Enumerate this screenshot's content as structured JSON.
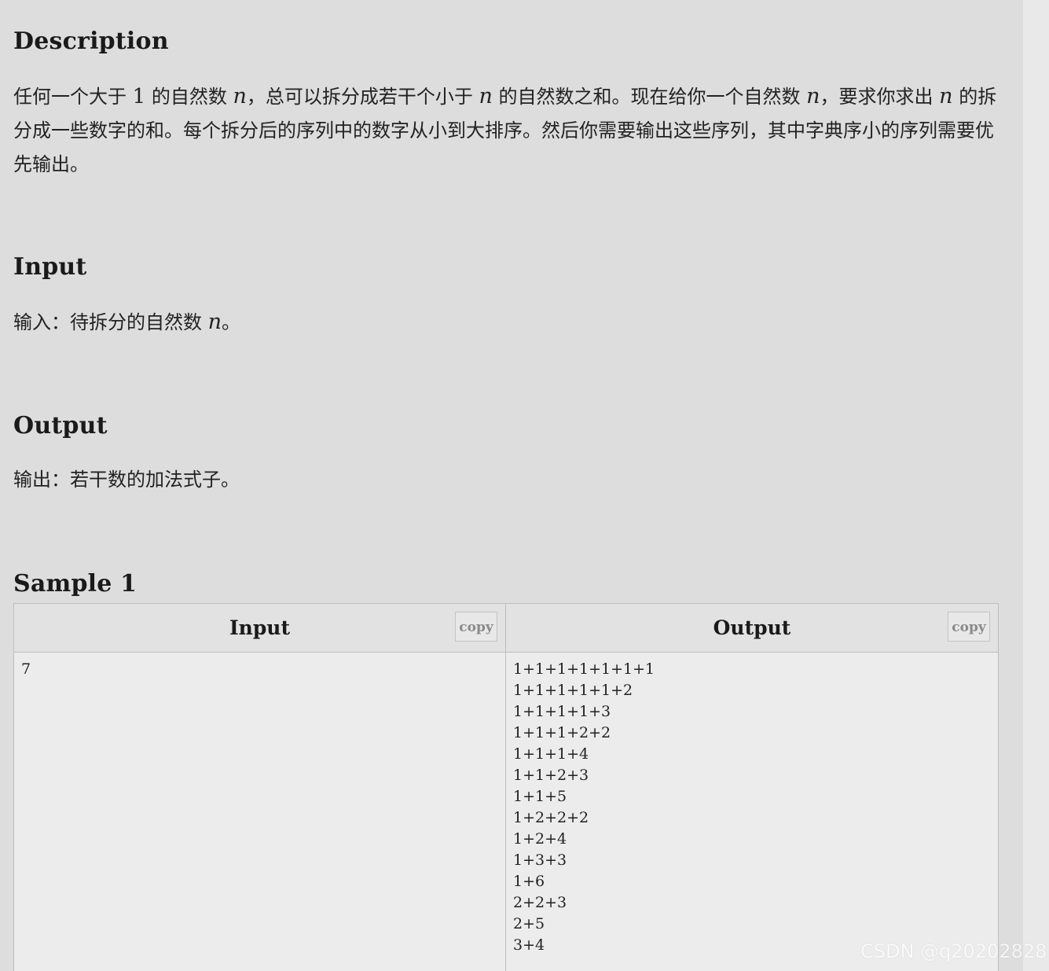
{
  "description": {
    "title": "Description",
    "text_1": "任何一个大于 ",
    "num_1": "1",
    "text_2": " 的自然数 ",
    "var_n1": "n",
    "text_3": "，总可以拆分成若干个小于 ",
    "var_n2": "n",
    "text_4": " 的自然数之和。现在给你一个自然数 ",
    "var_n3": "n",
    "text_5": "，要求你求出 ",
    "var_n4": "n",
    "text_6": " 的拆分成一些数字的和。每个拆分后的序列中的数字从小到大排序。然后你需要输出这些序列，其中字典序小的序列需要优先输出。"
  },
  "input_section": {
    "title": "Input",
    "text_1": "输入：待拆分的自然数 ",
    "var_n": "n",
    "text_2": "。"
  },
  "output_section": {
    "title": "Output",
    "text": "输出：若干数的加法式子。"
  },
  "sample": {
    "title": "Sample 1",
    "input_header": "Input",
    "output_header": "Output",
    "copy_label": "copy",
    "input_lines": [
      "7"
    ],
    "output_lines": [
      "1+1+1+1+1+1+1",
      "1+1+1+1+1+2",
      "1+1+1+1+3",
      "1+1+1+2+2",
      "1+1+1+4",
      "1+1+2+3",
      "1+1+5",
      "1+2+2+2",
      "1+2+4",
      "1+3+3",
      "1+6",
      "2+2+3",
      "2+5",
      "3+4"
    ]
  },
  "watermark": "CSDN @q20202828"
}
